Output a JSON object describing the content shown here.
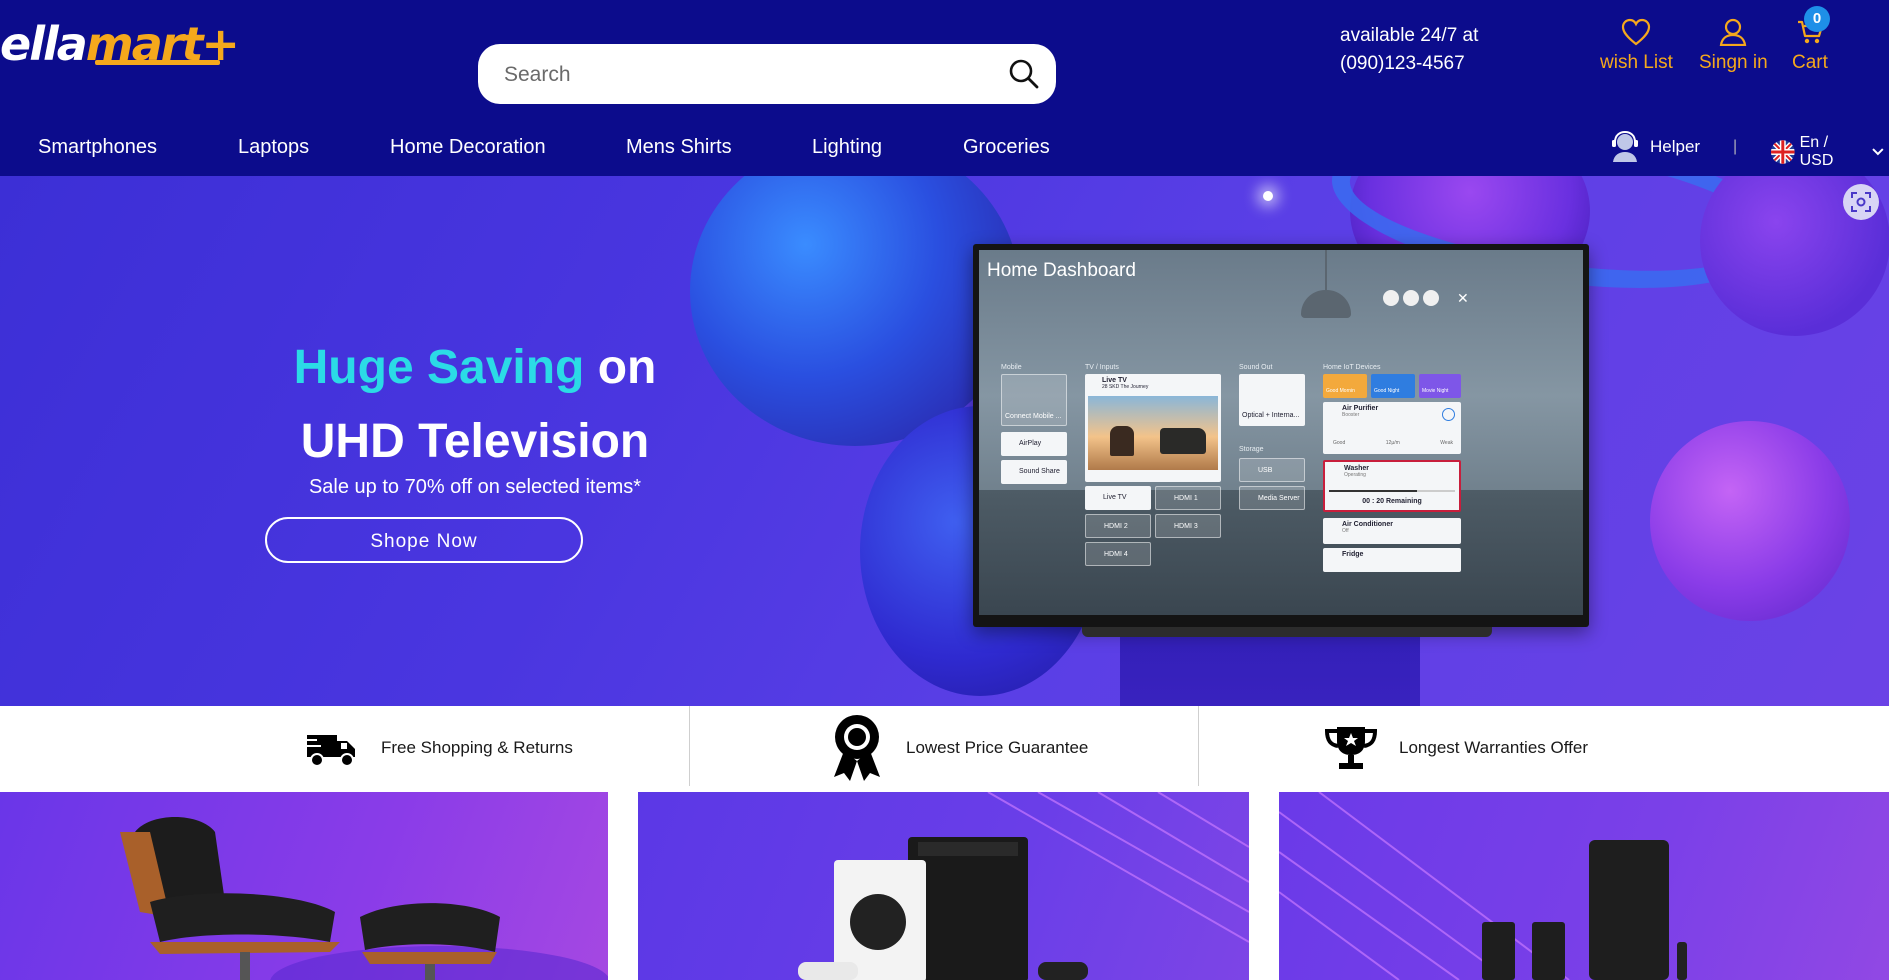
{
  "header": {
    "logo": {
      "part1": "ella",
      "part2": "mart+"
    },
    "search": {
      "placeholder": "Search",
      "value": ""
    },
    "availability": {
      "line1": "available 24/7 at",
      "line2": "(090)123-4567"
    },
    "actions": {
      "wishlist": "wish List",
      "signin": "Singn in",
      "cart": "Cart",
      "cart_count": "0"
    },
    "nav": [
      "Smartphones",
      "Laptops",
      "Home Decoration",
      "Mens Shirts",
      "Lighting",
      "Groceries"
    ],
    "helper": "Helper",
    "separator": "|",
    "language": "En / USD"
  },
  "hero": {
    "title_highlight": "Huge Saving",
    "title_rest1": "on",
    "title_line2": "UHD Television",
    "subtitle": "Sale up to 70% off on selected items*",
    "cta": "Shope Now",
    "dashboard": {
      "title": "Home Dashboard",
      "sections": {
        "mobile": "Mobile",
        "tv_inputs": "TV / Inputs",
        "sound_out": "Sound Out",
        "iot": "Home IoT Devices",
        "storage": "Storage"
      },
      "mobile_tiles": [
        "Connect Mobile ...",
        "AirPlay",
        "Sound Share"
      ],
      "tv_tiles": {
        "live_tv": "Live TV",
        "live_tv_sub": "28 SKD The Journey",
        "live_tv_small": "Live TV",
        "hdmi1": "HDMI 1",
        "hdmi2": "HDMI 2",
        "hdmi3": "HDMI 3",
        "hdmi4": "HDMI 4"
      },
      "sound_tile": "Optical + Interna...",
      "storage_tiles": [
        "USB",
        "Media Server"
      ],
      "iot_modes": [
        "Good Mornin",
        "Good Night",
        "Movie Night"
      ],
      "iot_devices": {
        "air_purifier": "Air Purifier",
        "air_purifier_sub": "Booster",
        "air_purifier_stats": [
          "Good",
          "12µ/m",
          "Weak"
        ],
        "washer": "Washer",
        "washer_sub": "Operating",
        "washer_time": "00 : 20 Remaining",
        "ac": "Air Conditioner",
        "ac_sub": "Off",
        "fridge": "Fridge"
      }
    }
  },
  "features": [
    {
      "label": "Free Shopping & Returns",
      "icon": "delivery-truck-icon"
    },
    {
      "label": "Lowest Price Guarantee",
      "icon": "award-ribbon-icon"
    },
    {
      "label": "Longest Warranties Offer",
      "icon": "trophy-icon"
    }
  ],
  "promo_cards": [
    {
      "product": "lounge chair",
      "icon": "chair-image"
    },
    {
      "product": "game consoles",
      "icon": "console-image"
    },
    {
      "product": "speakers",
      "icon": "speaker-image"
    }
  ],
  "colors": {
    "header_bg": "#0c0c8c",
    "accent": "#f5a81c",
    "hero_highlight": "#2bdbe6",
    "cart_badge": "#1e8fe8"
  }
}
